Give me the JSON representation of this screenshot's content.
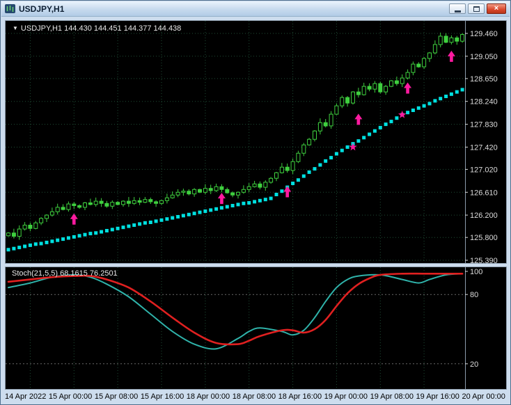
{
  "window": {
    "title": "USDJPY,H1",
    "controls": {
      "close_icon": "×"
    }
  },
  "chart_data": {
    "type": "candlestick",
    "symbol": "USDJPY",
    "timeframe": "H1",
    "ohlc_line": "USDJPY,H1 144.430 144.451 144.377 144.438",
    "collapse_icon": "▼",
    "x_labels": [
      "14 Apr 2022",
      "15 Apr 00:00",
      "15 Apr 08:00",
      "15 Apr 16:00",
      "18 Apr 00:00",
      "18 Apr 08:00",
      "18 Apr 16:00",
      "19 Apr 00:00",
      "19 Apr 08:00",
      "19 Apr 16:00",
      "20 Apr 00:00"
    ],
    "y_ticks": [
      "129.460",
      "129.050",
      "128.650",
      "128.240",
      "127.830",
      "127.420",
      "127.020",
      "126.610",
      "126.200",
      "125.800",
      "125.390"
    ],
    "closes": [
      125.88,
      125.82,
      125.95,
      126.02,
      125.96,
      126.06,
      126.14,
      126.2,
      126.26,
      126.34,
      126.3,
      126.4,
      126.37,
      126.34,
      126.42,
      126.39,
      126.45,
      126.41,
      126.36,
      126.43,
      126.39,
      126.45,
      126.41,
      126.46,
      126.43,
      126.48,
      126.44,
      126.41,
      126.46,
      126.51,
      126.56,
      126.61,
      126.63,
      126.58,
      126.66,
      126.61,
      126.68,
      126.64,
      126.71,
      126.66,
      126.6,
      126.56,
      126.61,
      126.66,
      126.71,
      126.76,
      126.7,
      126.79,
      126.86,
      126.96,
      127.06,
      127.0,
      127.16,
      127.31,
      127.46,
      127.56,
      127.71,
      127.86,
      127.8,
      128.01,
      128.16,
      128.31,
      128.21,
      128.41,
      128.36,
      128.51,
      128.46,
      128.56,
      128.41,
      128.51,
      128.61,
      128.56,
      128.66,
      128.76,
      128.91,
      128.86,
      129.01,
      129.11,
      129.26,
      129.41,
      129.3,
      129.38,
      129.32,
      129.44
    ],
    "support_dots": [
      125.58,
      125.6,
      125.62,
      125.64,
      125.66,
      125.68,
      125.69,
      125.71,
      125.73,
      125.75,
      125.77,
      125.79,
      125.81,
      125.83,
      125.85,
      125.87,
      125.88,
      125.9,
      125.92,
      125.94,
      125.96,
      125.98,
      126.0,
      126.02,
      126.04,
      126.06,
      126.07,
      126.09,
      126.11,
      126.13,
      126.15,
      126.17,
      126.19,
      126.21,
      126.23,
      126.25,
      126.27,
      126.29,
      126.31,
      126.33,
      126.35,
      126.37,
      126.39,
      126.41,
      126.42,
      126.44,
      126.46,
      126.48,
      126.5,
      126.57,
      126.63,
      126.7,
      126.77,
      126.83,
      126.9,
      126.97,
      127.03,
      127.1,
      127.17,
      127.23,
      127.3,
      127.36,
      127.42,
      127.48,
      127.53,
      127.59,
      127.65,
      127.71,
      127.77,
      127.83,
      127.88,
      127.94,
      128.0,
      128.04,
      128.08,
      128.12,
      128.16,
      128.2,
      128.25,
      128.29,
      128.33,
      128.37,
      128.41,
      128.45
    ],
    "signals": {
      "up_arrows": [
        {
          "index": 12,
          "price": 126.03
        },
        {
          "index": 39,
          "price": 126.4
        },
        {
          "index": 51,
          "price": 126.52
        },
        {
          "index": 64,
          "price": 127.82
        },
        {
          "index": 73,
          "price": 128.38
        },
        {
          "index": 81,
          "price": 128.95
        }
      ],
      "stars": [
        {
          "index": 63,
          "price": 127.42
        },
        {
          "index": 72,
          "price": 128.0
        }
      ]
    },
    "colors": {
      "background": "#000000",
      "grid": "#1f4e36",
      "candle": "#3fd03f",
      "support": "#00e0e0",
      "signal": "#ff1aa0",
      "stoch_main": "#2fb3aa",
      "stoch_signal": "#e02020",
      "axis_text": "#dcdcdc"
    },
    "stoch": {
      "display_line": "Stoch(21,5,5) 68.1615 76.2501",
      "y_ticks": [
        "100",
        "80",
        "20"
      ],
      "levels": [
        80,
        20
      ],
      "range": [
        0,
        100
      ],
      "main_knots": [
        [
          0,
          86
        ],
        [
          4,
          90
        ],
        [
          8,
          95
        ],
        [
          12,
          97
        ],
        [
          15,
          95
        ],
        [
          18,
          89
        ],
        [
          22,
          78
        ],
        [
          26,
          63
        ],
        [
          30,
          48
        ],
        [
          34,
          37
        ],
        [
          38,
          33
        ],
        [
          42,
          42
        ],
        [
          44,
          48
        ],
        [
          46,
          51
        ],
        [
          50,
          48
        ],
        [
          52,
          45
        ],
        [
          54,
          49
        ],
        [
          56,
          60
        ],
        [
          58,
          74
        ],
        [
          60,
          86
        ],
        [
          62,
          93
        ],
        [
          64,
          96
        ],
        [
          68,
          97
        ],
        [
          72,
          93
        ],
        [
          75,
          90
        ],
        [
          77,
          93
        ],
        [
          80,
          97
        ],
        [
          83,
          98
        ]
      ],
      "signal_knots": [
        [
          0,
          91
        ],
        [
          4,
          93
        ],
        [
          8,
          95
        ],
        [
          12,
          96
        ],
        [
          15,
          96
        ],
        [
          18,
          93
        ],
        [
          22,
          86
        ],
        [
          26,
          74
        ],
        [
          30,
          60
        ],
        [
          34,
          47
        ],
        [
          38,
          38
        ],
        [
          42,
          37
        ],
        [
          44,
          40
        ],
        [
          46,
          44
        ],
        [
          50,
          49
        ],
        [
          52,
          49
        ],
        [
          54,
          47
        ],
        [
          56,
          50
        ],
        [
          58,
          58
        ],
        [
          60,
          70
        ],
        [
          62,
          81
        ],
        [
          64,
          89
        ],
        [
          66,
          94
        ],
        [
          68,
          97
        ],
        [
          72,
          98
        ],
        [
          76,
          98
        ],
        [
          80,
          98
        ],
        [
          83,
          98
        ]
      ]
    }
  }
}
